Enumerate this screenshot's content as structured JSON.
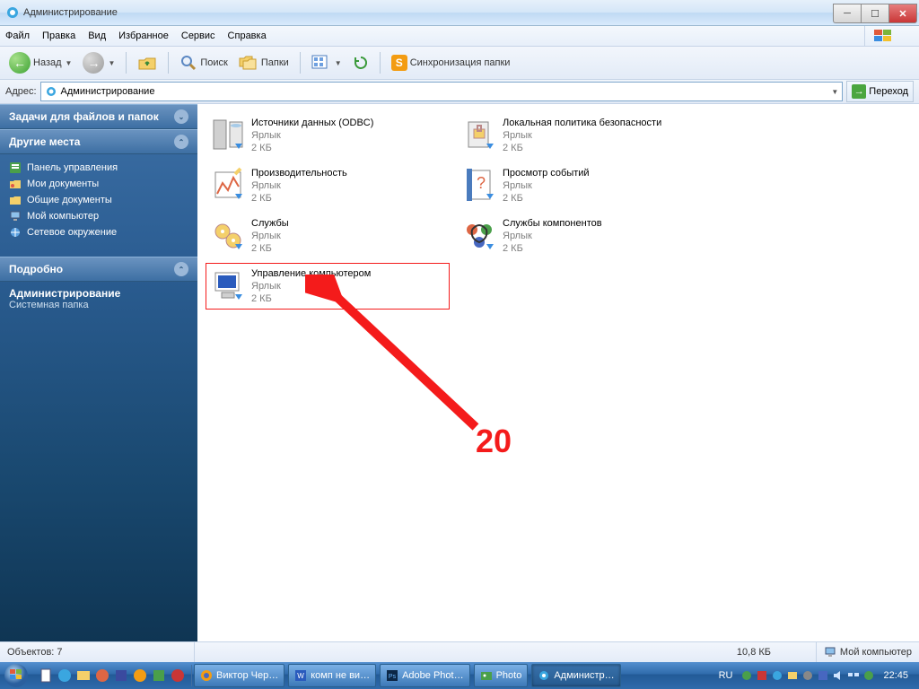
{
  "title": "Администрирование",
  "menu": [
    "Файл",
    "Правка",
    "Вид",
    "Избранное",
    "Сервис",
    "Справка"
  ],
  "toolbar": {
    "back": "Назад",
    "search": "Поиск",
    "folders": "Папки",
    "sync": "Синхронизация папки"
  },
  "address": {
    "label": "Адрес:",
    "value": "Администрирование",
    "go": "Переход"
  },
  "sidebar": {
    "sections": [
      {
        "title": "Задачи для файлов и папок",
        "collapsed": true
      },
      {
        "title": "Другие места",
        "collapsed": false,
        "items": [
          {
            "icon": "control-panel",
            "label": "Панель управления"
          },
          {
            "icon": "my-documents",
            "label": "Мои документы"
          },
          {
            "icon": "shared-docs",
            "label": "Общие документы"
          },
          {
            "icon": "my-computer",
            "label": "Мой компьютер"
          },
          {
            "icon": "network",
            "label": "Сетевое окружение"
          }
        ]
      },
      {
        "title": "Подробно",
        "collapsed": false
      }
    ],
    "details": {
      "title": "Администрирование",
      "subtitle": "Системная папка"
    }
  },
  "files": [
    {
      "icon": "odbc",
      "name": "Источники данных (ODBC)",
      "type": "Ярлык",
      "size": "2 КБ"
    },
    {
      "icon": "sec-policy",
      "name": "Локальная политика безопасности",
      "type": "Ярлык",
      "size": "2 КБ"
    },
    {
      "icon": "perf",
      "name": "Производительность",
      "type": "Ярлык",
      "size": "2 КБ"
    },
    {
      "icon": "event",
      "name": "Просмотр событий",
      "type": "Ярлык",
      "size": "2 КБ"
    },
    {
      "icon": "services",
      "name": "Службы",
      "type": "Ярлык",
      "size": "2 КБ"
    },
    {
      "icon": "comp-svc",
      "name": "Службы компонентов",
      "type": "Ярлык",
      "size": "2 КБ"
    },
    {
      "icon": "comp-mgmt",
      "name": "Управление компьютером",
      "type": "Ярлык",
      "size": "2 КБ",
      "selected": true
    }
  ],
  "annotation_label": "20",
  "status": {
    "objects": "Объектов: 7",
    "size": "10,8 КБ",
    "location": "Мой компьютер"
  },
  "taskbar": {
    "apps": [
      {
        "icon": "firefox",
        "label": "Виктор Чер…"
      },
      {
        "icon": "word",
        "label": "комп не ви…"
      },
      {
        "icon": "ps",
        "label": "Adobe Phot…"
      },
      {
        "icon": "photo",
        "label": "Photo"
      },
      {
        "icon": "admin",
        "label": "Администр…",
        "active": true
      }
    ],
    "lang": "RU",
    "time": "22:45"
  }
}
